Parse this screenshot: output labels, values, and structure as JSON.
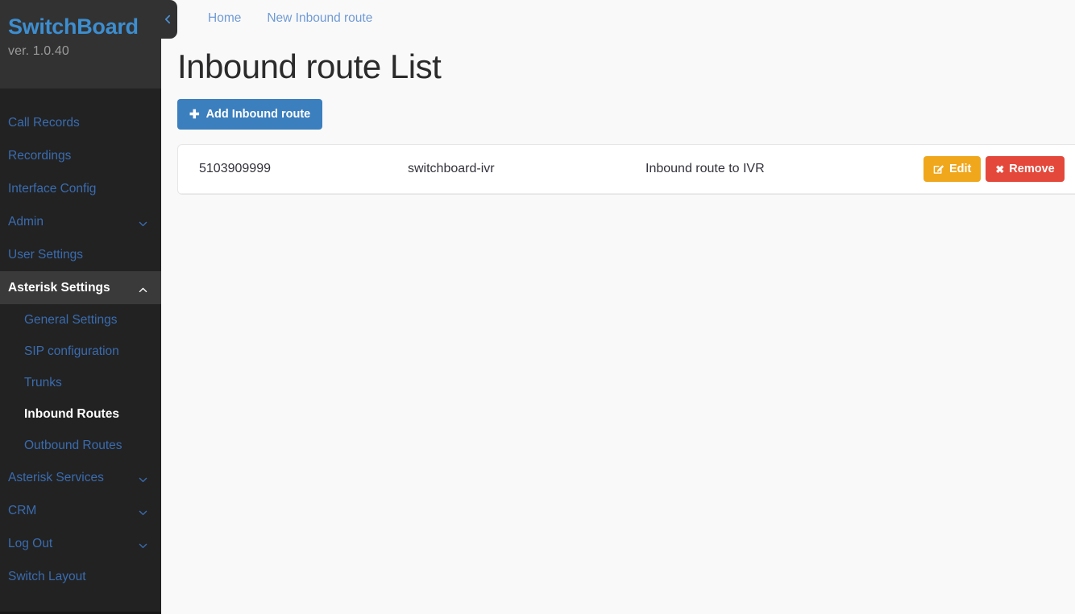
{
  "sidebar": {
    "brand": "SwitchBoard",
    "version": "ver. 1.0.40",
    "collapse_icon": "chevron-left-icon",
    "items": [
      {
        "label": "Call Records",
        "type": "link",
        "active": false,
        "chevron": ""
      },
      {
        "label": "Recordings",
        "type": "link",
        "active": false,
        "chevron": ""
      },
      {
        "label": "Interface Config",
        "type": "link",
        "active": false,
        "chevron": ""
      },
      {
        "label": "Admin",
        "type": "group",
        "active": false,
        "chevron": "chevron-down-icon"
      },
      {
        "label": "User Settings",
        "type": "link",
        "active": false,
        "chevron": ""
      },
      {
        "label": "Asterisk Settings",
        "type": "group",
        "active": true,
        "chevron": "chevron-up-icon"
      }
    ],
    "asterisk_settings_children": [
      {
        "label": "General Settings",
        "active": false
      },
      {
        "label": "SIP configuration",
        "active": false
      },
      {
        "label": "Trunks",
        "active": false
      },
      {
        "label": "Inbound Routes",
        "active": true
      },
      {
        "label": "Outbound Routes",
        "active": false
      }
    ],
    "items_after": [
      {
        "label": "Asterisk Services",
        "type": "group",
        "active": false,
        "chevron": "chevron-down-icon"
      },
      {
        "label": "CRM",
        "type": "group",
        "active": false,
        "chevron": "chevron-down-icon"
      },
      {
        "label": "Log Out",
        "type": "group",
        "active": false,
        "chevron": "chevron-down-icon"
      },
      {
        "label": "Switch Layout",
        "type": "link",
        "active": false,
        "chevron": ""
      }
    ]
  },
  "topbar": {
    "breadcrumbs": [
      {
        "label": "Home"
      },
      {
        "label": "New Inbound route"
      }
    ]
  },
  "page": {
    "title": "Inbound route List",
    "add_button": {
      "label": "Add Inbound route",
      "icon": "plus-icon",
      "glyph": "✚"
    }
  },
  "table": {
    "rows": [
      {
        "did": "5103909999",
        "context": "switchboard-ivr",
        "description": "Inbound route to IVR",
        "edit_label": "Edit",
        "edit_icon": "pencil-square-icon",
        "remove_label": "Remove",
        "remove_icon": "close-x-icon",
        "remove_glyph": "✖"
      }
    ]
  },
  "colors": {
    "sidebar_bg": "#222222",
    "sidebar_header_bg": "#323232",
    "sidebar_active_bg": "#3a3a3a",
    "link_blue": "#3a6cb0",
    "brand_blue": "#3d8ed0",
    "breadcrumb_blue": "#6f9ad4",
    "primary_button": "#3c7fbe",
    "edit_button": "#f0a71c",
    "remove_button": "#e4483b",
    "content_bg": "#f9f9fa"
  }
}
